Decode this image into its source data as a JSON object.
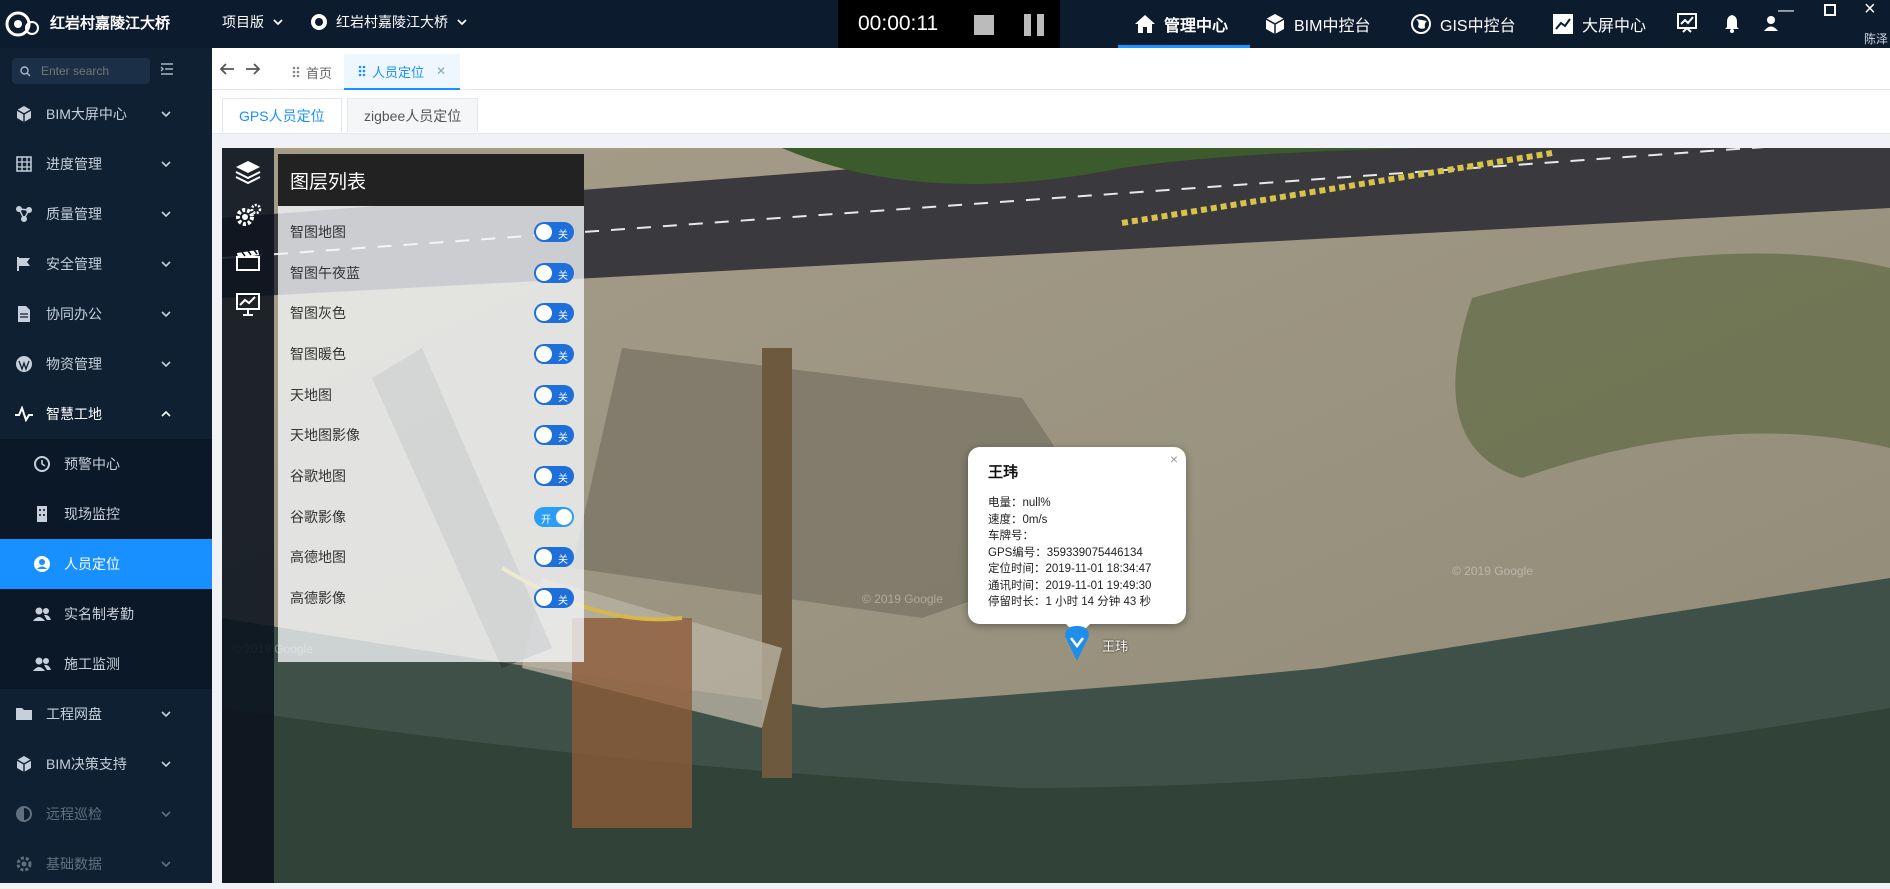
{
  "topbar": {
    "brand": "红岩村嘉陵江大桥",
    "edition": "项目版",
    "project": "红岩村嘉陵江大桥",
    "recorder_time": "00:00:11",
    "nav": [
      {
        "label": "管理中心",
        "icon": "home-icon"
      },
      {
        "label": "BIM中控台",
        "icon": "cube-icon"
      },
      {
        "label": "GIS中控台",
        "icon": "globe-icon"
      },
      {
        "label": "大屏中心",
        "icon": "chart-icon"
      }
    ],
    "user": "陈泽"
  },
  "sidebar": {
    "search_placeholder": "Enter search",
    "items": [
      {
        "label": "BIM大屏中心",
        "icon": "cube-icon"
      },
      {
        "label": "进度管理",
        "icon": "grid-icon"
      },
      {
        "label": "质量管理",
        "icon": "nodes-icon"
      },
      {
        "label": "安全管理",
        "icon": "flag-icon"
      },
      {
        "label": "协同办公",
        "icon": "document-icon"
      },
      {
        "label": "物资管理",
        "icon": "wordpress-icon"
      },
      {
        "label": "智慧工地",
        "icon": "pulse-icon"
      },
      {
        "label": "预警中心",
        "icon": "clock-icon"
      },
      {
        "label": "现场监控",
        "icon": "building-icon"
      },
      {
        "label": "人员定位",
        "icon": "user-circle-icon"
      },
      {
        "label": "实名制考勤",
        "icon": "users-icon"
      },
      {
        "label": "施工监测",
        "icon": "users-icon"
      },
      {
        "label": "工程网盘",
        "icon": "folder-icon"
      },
      {
        "label": "BIM决策支持",
        "icon": "cube-icon"
      },
      {
        "label": "远程巡检",
        "icon": "half-circle-icon"
      },
      {
        "label": "基础数据",
        "icon": "gear-icon"
      }
    ]
  },
  "tabs": {
    "home": "首页",
    "current": "人员定位"
  },
  "subtabs": {
    "gps": "GPS人员定位",
    "zigbee": "zigbee人员定位"
  },
  "layers": {
    "title": "图层列表",
    "off_text": "关",
    "on_text": "开",
    "items": [
      {
        "label": "智图地图",
        "on": false
      },
      {
        "label": "智图午夜蓝",
        "on": false
      },
      {
        "label": "智图灰色",
        "on": false
      },
      {
        "label": "智图暖色",
        "on": false
      },
      {
        "label": "天地图",
        "on": false
      },
      {
        "label": "天地图影像",
        "on": false
      },
      {
        "label": "谷歌地图",
        "on": false
      },
      {
        "label": "谷歌影像",
        "on": true
      },
      {
        "label": "高德地图",
        "on": false
      },
      {
        "label": "高德影像",
        "on": false
      }
    ]
  },
  "popup": {
    "name": "王玮",
    "close": "×",
    "lines": [
      {
        "k": "电量：",
        "v": "null%"
      },
      {
        "k": "速度：",
        "v": "0m/s"
      },
      {
        "k": "车牌号：",
        "v": ""
      },
      {
        "k": "GPS编号：",
        "v": "359339075446134"
      },
      {
        "k": "定位时间：",
        "v": "2019-11-01 18:34:47"
      },
      {
        "k": "通讯时间：",
        "v": "2019-11-01 19:49:30"
      },
      {
        "k": "停留时长：",
        "v": "1 小时 14 分钟 43 秒"
      }
    ]
  },
  "marker_label": "王玮",
  "watermark": "© 2019 Google"
}
